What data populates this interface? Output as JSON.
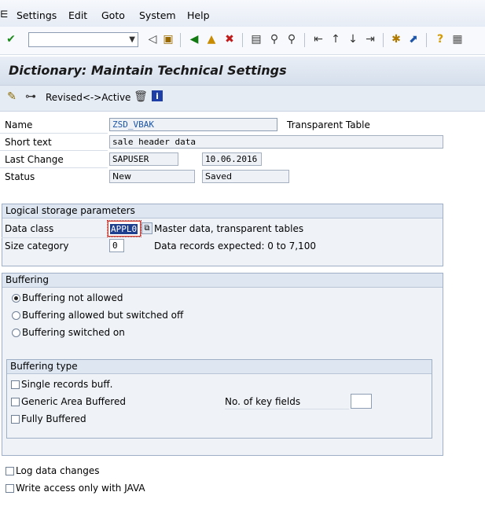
{
  "menu": {
    "items": [
      "Settings",
      "Edit",
      "Goto",
      "System",
      "Help"
    ]
  },
  "title": "Dictionary: Maintain Technical Settings",
  "app_toolbar": {
    "revised_active": "Revised<->Active"
  },
  "attributes": {
    "name_label": "Name",
    "name_value": "ZSD_VBAK",
    "table_type": "Transparent Table",
    "short_text_label": "Short text",
    "short_text_value": "sale header data",
    "last_change_label": "Last Change",
    "last_change_user": "SAPUSER",
    "last_change_date": "10.06.2016",
    "status_label": "Status",
    "status_value1": "New",
    "status_value2": "Saved"
  },
  "logical_storage": {
    "header": "Logical storage parameters",
    "data_class_label": "Data class",
    "data_class_value": "APPL0",
    "data_class_desc": "Master data, transparent tables",
    "size_category_label": "Size category",
    "size_category_value": "0",
    "size_desc": "Data records expected: 0 to 7,100"
  },
  "buffering": {
    "header": "Buffering",
    "options": [
      "Buffering not allowed",
      "Buffering allowed but switched off",
      "Buffering switched on"
    ],
    "selected_index": 0
  },
  "buffering_type": {
    "header": "Buffering type",
    "single": "Single records buff.",
    "generic": "Generic Area Buffered",
    "fully": "Fully Buffered",
    "key_fields_label": "No. of key fields",
    "key_fields_value": ""
  },
  "bottom_options": {
    "log_changes": "Log data changes",
    "java_write": "Write access only with JAVA"
  },
  "colors": {
    "selection": "#1f3f8f",
    "accent": "#1e55a6",
    "group_bg": "#eff3f8"
  },
  "icons": {
    "toolbar": [
      "check-icon",
      "back-icon",
      "save-icon",
      "nav-back-icon",
      "exit-icon",
      "cancel-icon",
      "print-icon",
      "find-icon",
      "find-next-icon",
      "first-page-icon",
      "prev-page-icon",
      "next-page-icon",
      "last-page-icon",
      "new-session-icon",
      "shortcut-icon",
      "help-icon",
      "layout-icon"
    ],
    "app_toolbar": [
      "edit-icon",
      "display-change-icon",
      "delete-icon",
      "info-icon"
    ]
  }
}
